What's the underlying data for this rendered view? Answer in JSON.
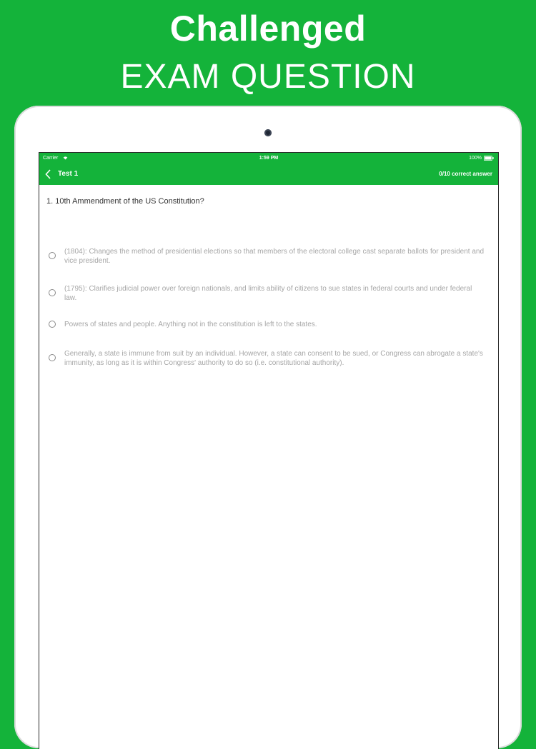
{
  "promo": {
    "title": "Challenged",
    "subtitle": "EXAM QUESTION"
  },
  "status_bar": {
    "carrier": "Carrier",
    "time": "1:59 PM",
    "battery": "100%",
    "wifi_icon": "wifi-icon",
    "battery_icon": "battery-icon"
  },
  "nav": {
    "back_icon": "chevron-left-icon",
    "title": "Test 1",
    "score": "0/10 correct answer"
  },
  "question": {
    "text": "1. 10th Ammendment of the US Constitution?"
  },
  "options": [
    {
      "text": "(1804): Changes the method of presidential elections so that members of the electoral college cast separate ballots for president and vice president.",
      "selected": false
    },
    {
      "text": "(1795): Clarifies judicial power over foreign nationals, and limits ability of citizens to sue states in federal courts and under federal law.",
      "selected": false
    },
    {
      "text": "Powers of states and people. Anything not in the constitution is left to the states.",
      "selected": false
    },
    {
      "text": "Generally, a state is immune from suit by an individual. However, a state can consent to be sued, or Congress can abrogate a state's immunity, as long as it is within Congress' authority to do so (i.e. constitutional authority).",
      "selected": false
    }
  ],
  "colors": {
    "brand_green": "#14b33a",
    "option_text": "#a6a6a6",
    "question_text": "#333333"
  }
}
